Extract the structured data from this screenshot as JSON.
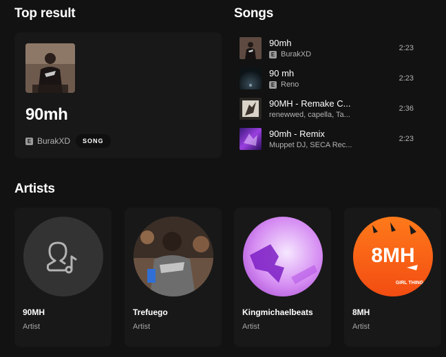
{
  "top_result": {
    "section_title": "Top result",
    "name": "90mh",
    "explicit_label": "E",
    "artist": "BurakXD",
    "type_badge": "SONG"
  },
  "songs": {
    "section_title": "Songs",
    "items": [
      {
        "title": "90mh",
        "explicit": "E",
        "artist": "BurakXD",
        "duration": "2:23"
      },
      {
        "title": "90 mh",
        "explicit": "E",
        "artist": "Reno",
        "duration": "2:23"
      },
      {
        "title": "90MH - Remake C...",
        "artist": "renewwed, capella, Ta...",
        "duration": "2:36"
      },
      {
        "title": "90mh - Remix",
        "artist": "Muppet DJ, SECA Rec...",
        "duration": "2:23"
      }
    ]
  },
  "artists": {
    "section_title": "Artists",
    "items": [
      {
        "name": "90MH",
        "type": "Artist",
        "icon": "artist-placeholder-icon"
      },
      {
        "name": "Trefuego",
        "type": "Artist"
      },
      {
        "name": "Kingmichaelbeats",
        "type": "Artist"
      },
      {
        "name": "8MH",
        "type": "Artist",
        "art_text": "8MH",
        "art_subtext": "GIRL THING"
      }
    ]
  },
  "colors": {
    "background": "#121212",
    "card": "#181818",
    "text_secondary": "#b3b3b3"
  }
}
